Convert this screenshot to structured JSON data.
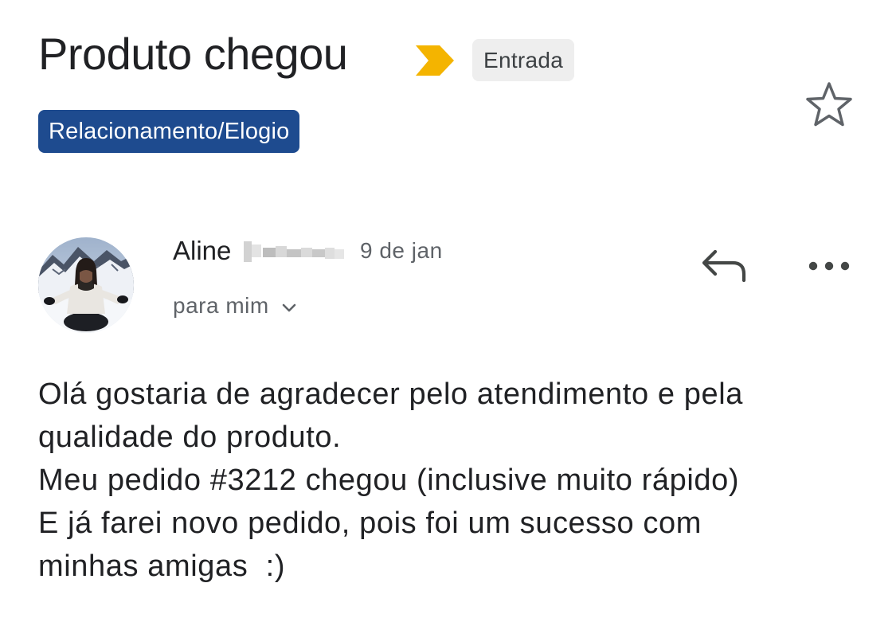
{
  "email": {
    "subject": "Produto chegou",
    "folder_label": "Entrada",
    "custom_label": "Relacionamento/Elogio",
    "label_color": "#1e4b8f",
    "importance_color": "#f4b400",
    "sender": {
      "first_name": "Aline",
      "surname_redacted": true,
      "date": "9 de jan",
      "recipient": "para mim"
    },
    "body_lines": [
      "Olá gostaria de agradecer pelo atendimento e pela",
      "qualidade do produto.",
      "Meu pedido #3212 chegou (inclusive muito rápido)",
      "E já farei novo pedido, pois foi um sucesso com",
      "minhas amigas  :)"
    ]
  },
  "icons": {
    "importance": "importance-marker-icon",
    "star": "star-outline-icon",
    "reply": "reply-icon",
    "more": "more-horizontal-icon",
    "expand": "chevron-down-icon"
  }
}
